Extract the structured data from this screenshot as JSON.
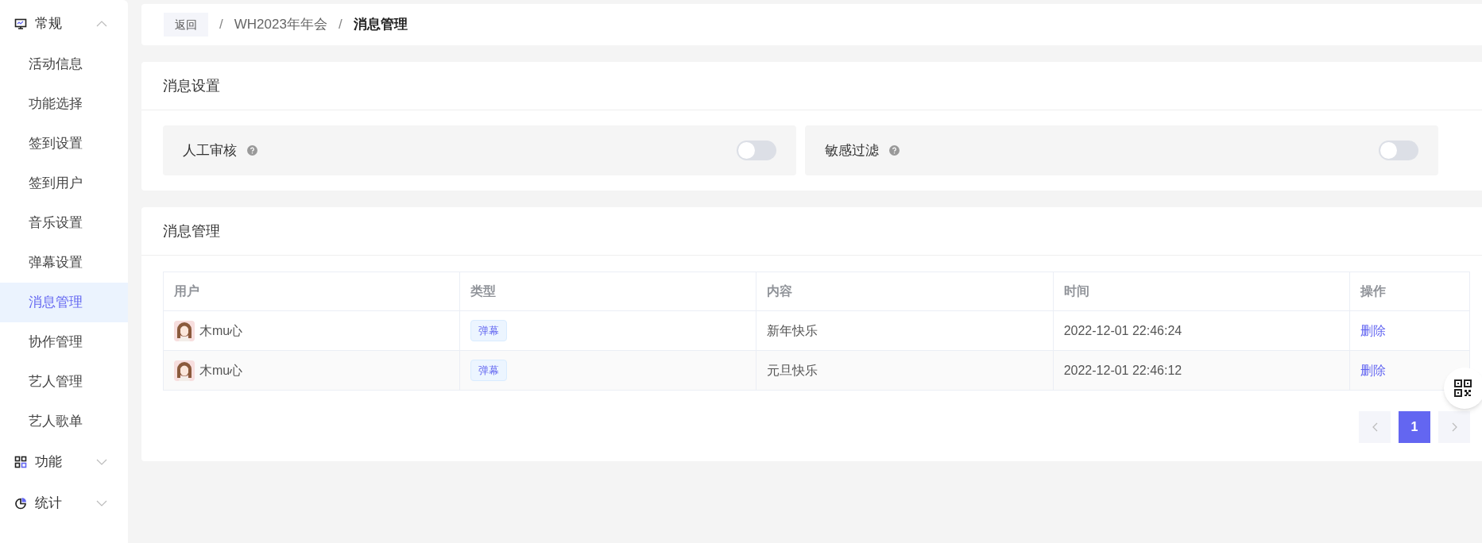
{
  "sidebar": {
    "groups": [
      {
        "label": "常规",
        "kind": "monitor",
        "expanded": true,
        "items": [
          {
            "label": "活动信息",
            "selected": false
          },
          {
            "label": "功能选择",
            "selected": false
          },
          {
            "label": "签到设置",
            "selected": false
          },
          {
            "label": "签到用户",
            "selected": false
          },
          {
            "label": "音乐设置",
            "selected": false
          },
          {
            "label": "弹幕设置",
            "selected": false
          },
          {
            "label": "消息管理",
            "selected": true
          },
          {
            "label": "协作管理",
            "selected": false
          },
          {
            "label": "艺人管理",
            "selected": false
          },
          {
            "label": "艺人歌单",
            "selected": false
          }
        ]
      },
      {
        "label": "功能",
        "kind": "grid",
        "expanded": false
      },
      {
        "label": "统计",
        "kind": "pie",
        "expanded": false
      }
    ]
  },
  "breadcrumb": {
    "back": "返回",
    "items": [
      {
        "label": "WH2023年年会",
        "current": false
      },
      {
        "label": "消息管理",
        "current": true
      }
    ],
    "separator": "/"
  },
  "settings": {
    "title": "消息设置",
    "toggles": [
      {
        "label": "人工审核",
        "on": false
      },
      {
        "label": "敏感过滤",
        "on": false
      }
    ]
  },
  "messages": {
    "title": "消息管理",
    "table": {
      "columns": [
        "用户",
        "类型",
        "内容",
        "时间",
        "操作"
      ],
      "rows": [
        {
          "user": "木mu心",
          "type": "弹幕",
          "content": "新年快乐",
          "time": "2022-12-01 22:46:24",
          "action": "删除"
        },
        {
          "user": "木mu心",
          "type": "弹幕",
          "content": "元旦快乐",
          "time": "2022-12-01 22:46:12",
          "action": "删除"
        }
      ]
    },
    "pagination": {
      "pages": [
        {
          "label": "1",
          "selected": true
        }
      ]
    }
  }
}
